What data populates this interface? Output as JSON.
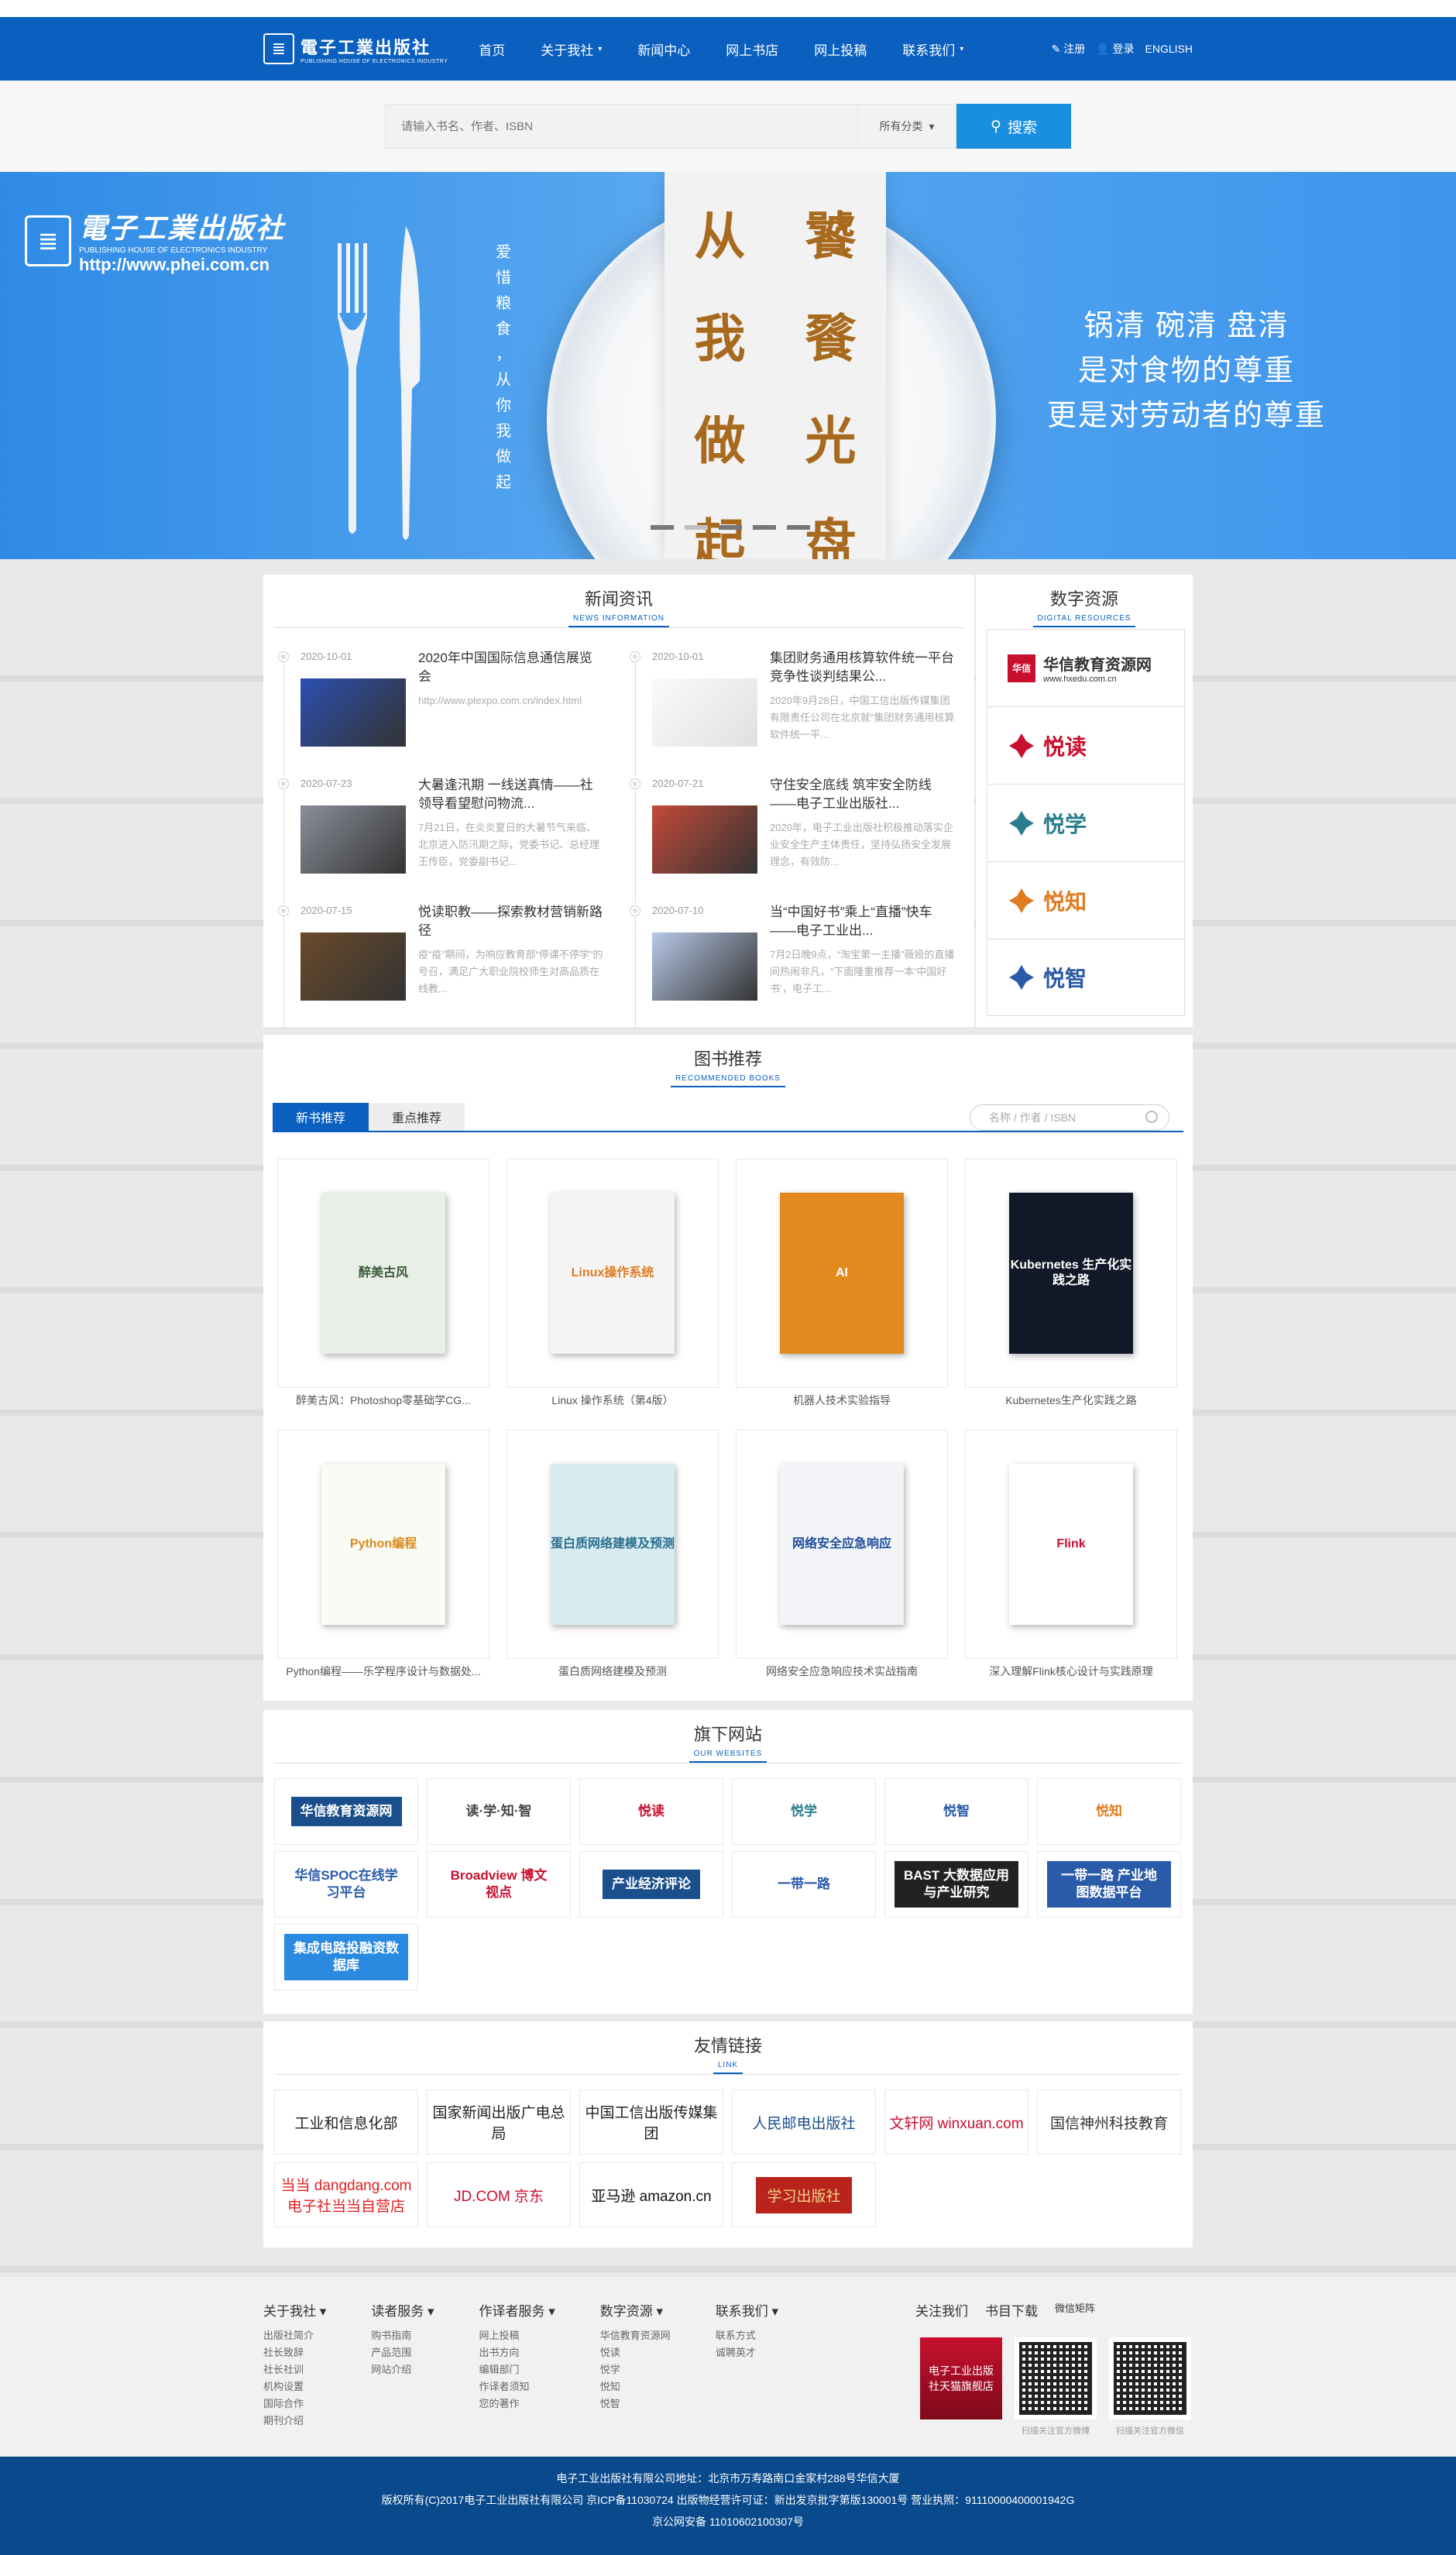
{
  "header": {
    "logo_cn": "電子工業出版社",
    "logo_en": "PUBLISHING HOUSE OF ELECTRONICS INDUSTRY",
    "nav": [
      {
        "label": "首页",
        "dropdown": false
      },
      {
        "label": "关于我社",
        "dropdown": true
      },
      {
        "label": "新闻中心",
        "dropdown": false
      },
      {
        "label": "网上书店",
        "dropdown": false
      },
      {
        "label": "网上投稿",
        "dropdown": false
      },
      {
        "label": "联系我们",
        "dropdown": true
      }
    ],
    "register": "注册",
    "login": "登录",
    "english": "ENGLISH"
  },
  "search": {
    "placeholder": "请输入书名、作者、ISBN",
    "category": "所有分类",
    "button": "搜索"
  },
  "banner": {
    "logo_cn": "電子工業出版社",
    "logo_en": "PUBLISHING HOUSE OF ELECTRONICS INDUSTRY",
    "url": "http://www.phei.com.cn",
    "vertical": [
      "爱",
      "惜",
      "粮",
      "食",
      "，",
      "从",
      "你",
      "我",
      "做",
      "起"
    ],
    "paper": [
      "从",
      "饕",
      "我",
      "餮",
      "做",
      "光",
      "起",
      "盘"
    ],
    "slogan": [
      "锅清 碗清 盘清",
      "是对食物的尊重",
      "更是对劳动者的尊重"
    ],
    "slides": 5,
    "active_slide": 1
  },
  "news": {
    "title": "新闻资讯",
    "subtitle": "NEWS INFORMATION",
    "items": [
      {
        "date": "2020-10-01",
        "title": "2020年中国国际信息通信展览会",
        "desc": "http://www.ptexpo.com.cn/index.html"
      },
      {
        "date": "2020-10-01",
        "title": "集团财务通用核算软件统一平台竞争性谈判结果公...",
        "desc": "2020年9月28日，中国工信出版传媒集团有限责任公司在北京就“集团财务通用核算软件统一平..."
      },
      {
        "date": "2020-07-23",
        "title": "大暑逢汛期 一线送真情——社领导看望慰问物流...",
        "desc": "7月21日，在炎炎夏日的大暑节气来临、北京进入防汛期之际，党委书记、总经理王传臣，党委副书记..."
      },
      {
        "date": "2020-07-21",
        "title": "守住安全底线 筑牢安全防线——电子工业出版社...",
        "desc": "2020年，电子工业出版社积极推动落实企业安全生产主体责任，坚持弘扬安全发展理念，有效防..."
      },
      {
        "date": "2020-07-15",
        "title": "悦读职教——探索教材营销新路径",
        "desc": "疫“疫”期间，为响应教育部“停课不停学”的号召，满足广大职业院校师生对高品质在线教..."
      },
      {
        "date": "2020-07-10",
        "title": "当“中国好书”乘上“直播”快车——电子工业出...",
        "desc": "7月2日晚9点，“淘宝第一主播”薇娅的直播间热闹非凡，“下面隆重推荐一本‘中国好书’，电子工..."
      }
    ]
  },
  "digital": {
    "title": "数字资源",
    "subtitle": "DIGITAL RESOURCES",
    "items": [
      {
        "name": "华信教育资源网",
        "sub": "www.hxedu.com.cn",
        "color": "#c8102e"
      },
      {
        "name": "悦读",
        "color": "#c8102e"
      },
      {
        "name": "悦学",
        "color": "#2a7d8c"
      },
      {
        "name": "悦知",
        "color": "#e07b20"
      },
      {
        "name": "悦智",
        "color": "#2a5ba8"
      }
    ]
  },
  "books": {
    "title": "图书推荐",
    "subtitle": "RECOMMENDED BOOKS",
    "tabs": [
      "新书推荐",
      "重点推荐"
    ],
    "search_placeholder": "名称 / 作者 / ISBN",
    "items": [
      {
        "title": "醉美古风：Photoshop零基础学CG...",
        "cover_text": "醉美古风",
        "bg": "#e8efe6",
        "fg": "#3a5a3a"
      },
      {
        "title": "Linux 操作系统（第4版）",
        "cover_text": "Linux操作系统",
        "bg": "#f5f5f5",
        "fg": "#e07b20"
      },
      {
        "title": "机器人技术实验指导",
        "cover_text": "AI",
        "bg": "#e38a1f",
        "fg": "#ffffff"
      },
      {
        "title": "Kubernetes生产化实践之路",
        "cover_text": "Kubernetes 生产化实践之路",
        "bg": "#111827",
        "fg": "#ffffff"
      },
      {
        "title": "Python编程——乐学程序设计与数据处...",
        "cover_text": "Python编程",
        "bg": "#fbfbf6",
        "fg": "#d98a1a"
      },
      {
        "title": "蛋白质网络建模及预测",
        "cover_text": "蛋白质网络建模及预测",
        "bg": "#d8ecf2",
        "fg": "#2a6f8c"
      },
      {
        "title": "网络安全应急响应技术实战指南",
        "cover_text": "网络安全应急响应",
        "bg": "#f2f4f8",
        "fg": "#1e4c9a"
      },
      {
        "title": "深入理解Flink核心设计与实践原理",
        "cover_text": "Flink",
        "bg": "#ffffff",
        "fg": "#c8102e"
      }
    ]
  },
  "sites": {
    "title": "旗下网站",
    "subtitle": "OUR WEBSITES",
    "items": [
      {
        "label": "华信教育资源网",
        "color": "#c8102e",
        "bg": "#1a4f8c",
        "fg": "#fff"
      },
      {
        "label": "读·学·知·智",
        "color": "#2a5ba8",
        "bg": "#fff",
        "fg": "#444"
      },
      {
        "label": "悦读",
        "color": "#c8102e",
        "bg": "#fff",
        "fg": "#c8102e"
      },
      {
        "label": "悦学",
        "color": "#2a7d8c",
        "bg": "#fff",
        "fg": "#2a7d8c"
      },
      {
        "label": "悦智",
        "color": "#2a5ba8",
        "bg": "#fff",
        "fg": "#2a5ba8"
      },
      {
        "label": "悦知",
        "color": "#e07b20",
        "bg": "#fff",
        "fg": "#e07b20"
      },
      {
        "label": "华信SPOC在线学习平台",
        "color": "#2a5ba8",
        "bg": "#fff",
        "fg": "#2a5ba8"
      },
      {
        "label": "Broadview 博文视点",
        "color": "#c8102e",
        "bg": "#fff",
        "fg": "#c8102e"
      },
      {
        "label": "产业经济评论",
        "color": "#1a4f8c",
        "bg": "#1a4f8c",
        "fg": "#fff"
      },
      {
        "label": "一带一路",
        "color": "#2a5ba8",
        "bg": "#fff",
        "fg": "#2a5ba8"
      },
      {
        "label": "BAST 大数据应用与产业研究",
        "color": "#333",
        "bg": "#222",
        "fg": "#fff"
      },
      {
        "label": "一带一路 产业地图数据平台",
        "color": "#2a5ba8",
        "bg": "#2a5ba8",
        "fg": "#fff"
      },
      {
        "label": "集成电路投融资数据库",
        "color": "#2a8ae0",
        "bg": "#2a8ae0",
        "fg": "#fff"
      }
    ]
  },
  "links": {
    "title": "友情链接",
    "subtitle": "LINK",
    "items": [
      {
        "label": "工业和信息化部",
        "fg": "#222"
      },
      {
        "label": "国家新闻出版广电总局",
        "fg": "#222"
      },
      {
        "label": "中国工信出版传媒集团",
        "fg": "#222"
      },
      {
        "label": "人民邮电出版社",
        "fg": "#1a4f8c"
      },
      {
        "label": "文轩网 winxuan.com",
        "fg": "#c8102e"
      },
      {
        "label": "国信神州科技教育",
        "fg": "#333"
      },
      {
        "label": "当当 dangdang.com 电子社当当自营店",
        "fg": "#e02020"
      },
      {
        "label": "JD.COM 京东",
        "fg": "#c8102e"
      },
      {
        "label": "亚马逊 amazon.cn",
        "fg": "#111"
      },
      {
        "label": "学习出版社",
        "fg": "#f2d38a"
      }
    ]
  },
  "footer": {
    "columns": [
      {
        "title": "关于我社",
        "items": [
          "出版社简介",
          "社长致辞",
          "社长社训",
          "机构设置",
          "国际合作",
          "期刊介绍"
        ]
      },
      {
        "title": "读者服务",
        "items": [
          "购书指南",
          "产品范围",
          "网站介绍"
        ]
      },
      {
        "title": "作译者服务",
        "items": [
          "网上投稿",
          "出书方向",
          "编辑部门",
          "作译者须知",
          "您的著作"
        ]
      },
      {
        "title": "数字资源",
        "items": [
          "华信教育资源网",
          "悦读",
          "悦学",
          "悦知",
          "悦智"
        ]
      },
      {
        "title": "联系我们",
        "items": [
          "联系方式",
          "诚聘英才"
        ]
      }
    ],
    "follow": "关注我们",
    "book_download": "书目下载",
    "weixin_matrix": "微信矩阵",
    "shop_card": "电子工业出版社天猫旗舰店",
    "qr1_caption": "扫描关注官方微博",
    "qr2_caption": "扫描关注官方微信",
    "copyright": [
      "电子工业出版社有限公司地址：北京市万寿路南口金家村288号华信大厦",
      "版权所有(C)2017电子工业出版社有限公司      京ICP备11030724      出版物经营许可证：新出发京批字第版130001号      营业执照：91110000400001942G",
      "京公网安备 11010602100307号"
    ]
  }
}
